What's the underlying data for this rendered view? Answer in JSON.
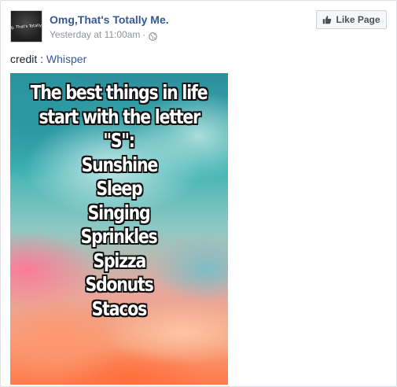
{
  "post": {
    "page_name": "Omg,That's Totally Me.",
    "avatar_text": "Omg, That's Totally Me",
    "timestamp": "Yesterday at 11:00am",
    "meta_separator": "·",
    "like_button_label": "Like Page",
    "credit_prefix": "credit : ",
    "credit_source": "Whisper",
    "icons": {
      "privacy": "globe-icon",
      "like": "thumbs-up-icon"
    },
    "colors": {
      "link": "#365899",
      "meta": "#90949c",
      "text": "#1d2129",
      "button_bg": "#f6f7f9"
    }
  },
  "image": {
    "lines": [
      "The best things in life",
      "start with the letter",
      "\"S\":",
      "Sunshine",
      "Sleep",
      "Singing",
      "Sprinkles",
      "Spizza",
      "Sdonuts",
      "Stacos"
    ]
  }
}
